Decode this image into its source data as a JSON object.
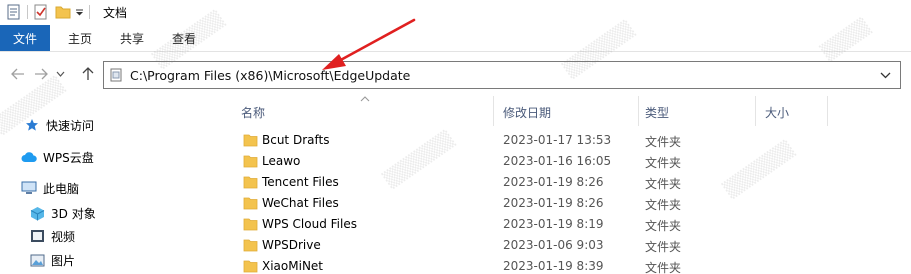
{
  "window": {
    "title": "文档"
  },
  "ribbon": {
    "tabs": [
      "文件",
      "主页",
      "共享",
      "查看"
    ]
  },
  "address": {
    "path": "C:\\Program Files (x86)\\Microsoft\\EdgeUpdate"
  },
  "sidebar": {
    "items": [
      {
        "label": "快速访问",
        "icon": "star-icon"
      },
      {
        "label": "WPS云盘",
        "icon": "cloud-icon"
      },
      {
        "label": "此电脑",
        "icon": "computer-icon"
      },
      {
        "label": "3D 对象",
        "icon": "cube-icon"
      },
      {
        "label": "视频",
        "icon": "video-icon"
      },
      {
        "label": "图片",
        "icon": "picture-icon"
      }
    ]
  },
  "filelist": {
    "headers": {
      "name": "名称",
      "date": "修改日期",
      "type": "类型",
      "size": "大小"
    },
    "rows": [
      {
        "name": "Bcut Drafts",
        "date": "2023-01-17 13:53",
        "type": "文件夹"
      },
      {
        "name": "Leawo",
        "date": "2023-01-16 16:05",
        "type": "文件夹"
      },
      {
        "name": "Tencent Files",
        "date": "2023-01-19 8:26",
        "type": "文件夹"
      },
      {
        "name": "WeChat Files",
        "date": "2023-01-19 8:26",
        "type": "文件夹"
      },
      {
        "name": "WPS Cloud Files",
        "date": "2023-01-19 8:19",
        "type": "文件夹"
      },
      {
        "name": "WPSDrive",
        "date": "2023-01-06 9:03",
        "type": "文件夹"
      },
      {
        "name": "XiaoMiNet",
        "date": "2023-01-19 8:39",
        "type": "文件夹"
      }
    ]
  },
  "colors": {
    "file_tab": "#1a66b8",
    "folder": "#f3c34e",
    "annotation": "#e02020"
  }
}
